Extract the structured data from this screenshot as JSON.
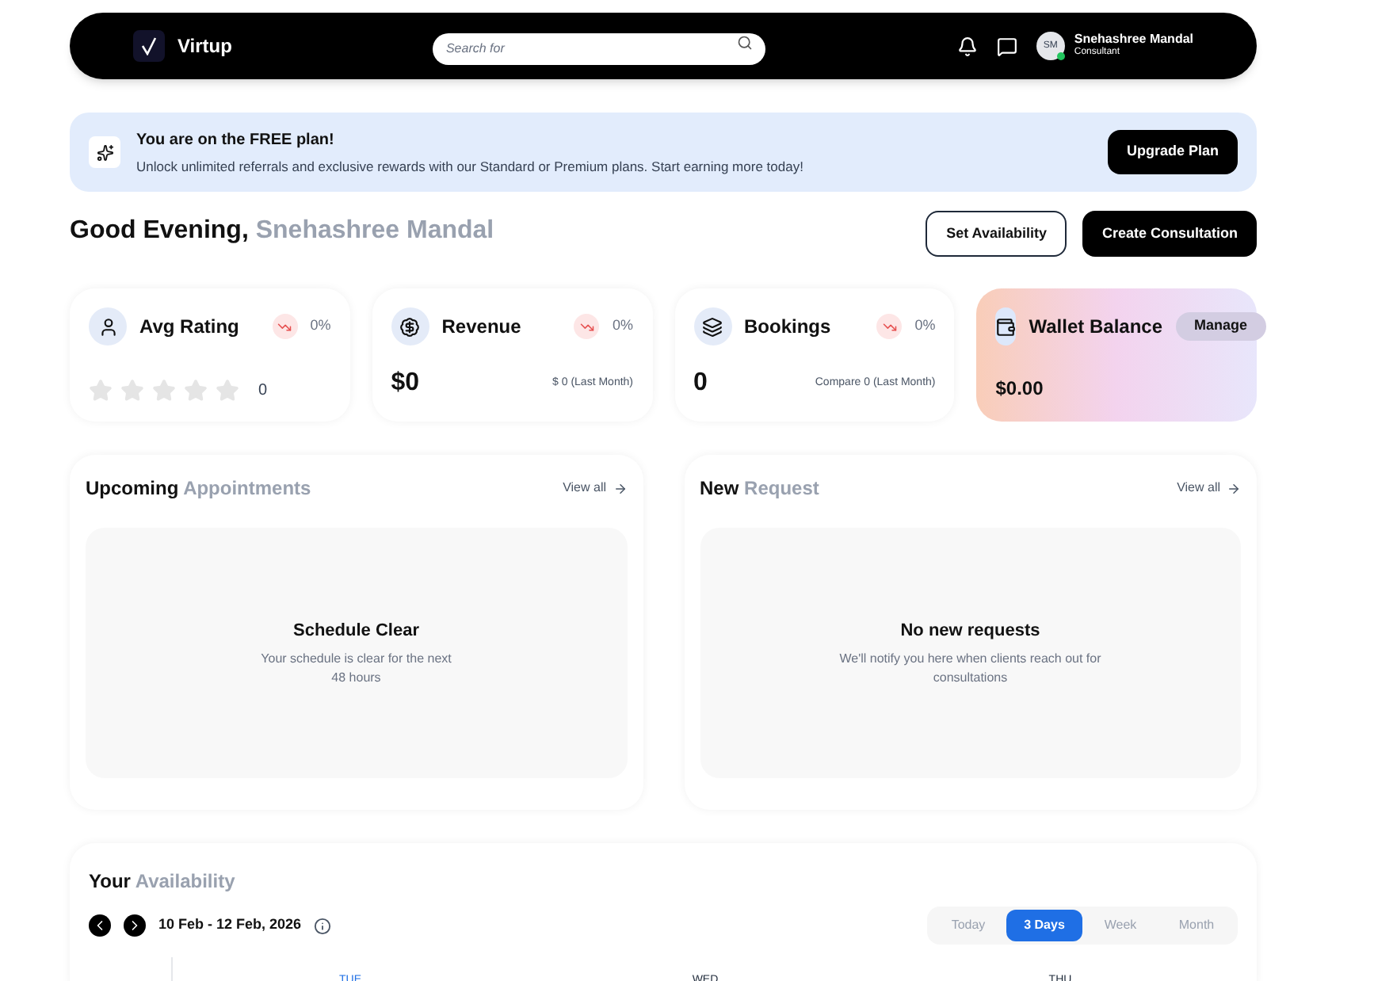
{
  "navbar": {
    "brand": "Virtup",
    "search": {
      "placeholder": "Search for"
    },
    "user": {
      "initials": "SM",
      "name": "Snehashree Mandal",
      "role": "Consultant",
      "online": true
    }
  },
  "banner": {
    "title": "You are on the FREE plan!",
    "text": "Unlock unlimited referrals and exclusive rewards with our Standard or Premium plans. Start earning more today!",
    "button": "Upgrade Plan"
  },
  "greeting": {
    "salutation": "Good Evening,",
    "name": "Snehashree Mandal"
  },
  "actions": [
    {
      "label": "Set Availability",
      "kind": "outline"
    },
    {
      "label": "Create Consultation",
      "kind": "solid"
    }
  ],
  "stats": [
    {
      "kind": "rating",
      "title": "Avg Rating",
      "change": "0%",
      "stars": 0,
      "value": "0"
    },
    {
      "kind": "revenue",
      "title": "Revenue",
      "change": "0%",
      "value": "$0",
      "compare": "$ 0 (Last Month)"
    },
    {
      "kind": "bookings",
      "title": "Bookings",
      "change": "0%",
      "value": "0",
      "compare": "Compare 0 (Last Month)"
    },
    {
      "kind": "wallet",
      "title": "Wallet Balance",
      "button": "Manage",
      "value": "$0.00"
    }
  ],
  "panels": [
    {
      "title": "Upcoming",
      "title_muted": "Appointments",
      "link": "View all",
      "empty_title": "Schedule Clear",
      "empty_text": "Your schedule is clear for the next 48 hours"
    },
    {
      "title": "New",
      "title_muted": "Request",
      "link": "View all",
      "empty_title": "No new requests",
      "empty_text": "We'll notify you here when clients reach out for consultations"
    }
  ],
  "availability": {
    "title": "Your",
    "title_muted": "Availability",
    "range": "10 Feb - 12 Feb, 2026",
    "views": [
      {
        "label": "Today",
        "selected": false
      },
      {
        "label": "3 Days",
        "selected": true
      },
      {
        "label": "Week",
        "selected": false
      },
      {
        "label": "Month",
        "selected": false
      }
    ],
    "days": [
      {
        "label": "TUE",
        "today": true
      },
      {
        "label": "WED",
        "today": false
      },
      {
        "label": "THU",
        "today": false
      }
    ]
  }
}
